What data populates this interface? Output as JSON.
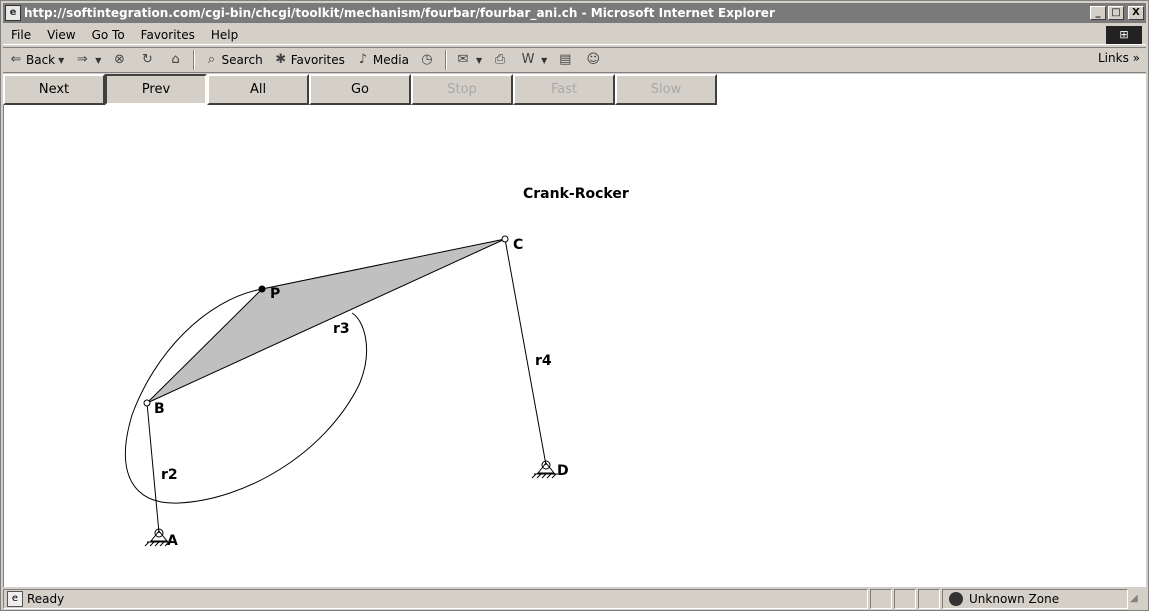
{
  "window": {
    "title": "http://softintegration.com/cgi-bin/chcgi/toolkit/mechanism/fourbar/fourbar_ani.ch - Microsoft Internet Explorer",
    "buttons": [
      "_",
      "□",
      "X"
    ]
  },
  "menu": {
    "items": [
      "File",
      "View",
      "Go To",
      "Favorites",
      "Help"
    ]
  },
  "toolbar": {
    "back": "Back",
    "search": "Search",
    "favorites": "Favorites",
    "media": "Media",
    "links": "Links"
  },
  "applet": {
    "buttons": [
      {
        "label": "Next",
        "state": "normal"
      },
      {
        "label": "Prev",
        "state": "pressed"
      },
      {
        "label": "All",
        "state": "normal"
      },
      {
        "label": "Go",
        "state": "normal"
      },
      {
        "label": "Stop",
        "state": "disabled"
      },
      {
        "label": "Fast",
        "state": "disabled"
      },
      {
        "label": "Slow",
        "state": "disabled"
      }
    ]
  },
  "diagram": {
    "title": "Crank-Rocker",
    "points": {
      "A": "A",
      "B": "B",
      "C": "C",
      "D": "D",
      "P": "P"
    },
    "links": {
      "r2": "r2",
      "r3": "r3",
      "r4": "r4"
    }
  },
  "status": {
    "text": "Ready",
    "zone": "Unknown Zone"
  },
  "colors": {
    "coupler_fill": "#c0c0c0",
    "titlebar": "#7a7a7a"
  }
}
